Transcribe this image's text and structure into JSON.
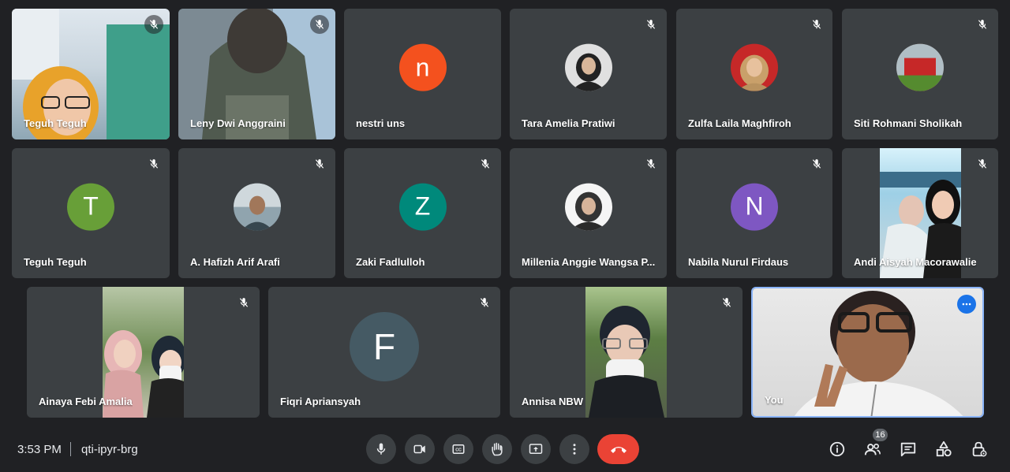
{
  "participants": [
    {
      "name": "Teguh Teguh",
      "tile": "video",
      "muted": true
    },
    {
      "name": "Leny Dwi Anggraini",
      "tile": "video",
      "muted": true
    },
    {
      "name": "nestri uns",
      "tile": "letter-avatar",
      "letter": "n",
      "avatar_color": "#f4511e",
      "muted": false
    },
    {
      "name": "Tara Amelia Pratiwi",
      "tile": "photo-avatar",
      "muted": true
    },
    {
      "name": "Zulfa Laila Maghfiroh",
      "tile": "photo-avatar",
      "muted": true
    },
    {
      "name": "Siti Rohmani Sholikah",
      "tile": "photo-avatar",
      "muted": true
    },
    {
      "name": "Teguh Teguh",
      "tile": "letter-avatar",
      "letter": "T",
      "avatar_color": "#689f38",
      "muted": true
    },
    {
      "name": "A. Hafizh Arif Arafi",
      "tile": "photo-avatar",
      "muted": true
    },
    {
      "name": "Zaki Fadlulloh",
      "tile": "letter-avatar",
      "letter": "Z",
      "avatar_color": "#00897b",
      "muted": true
    },
    {
      "name": "Millenia Anggie Wangsa P...",
      "tile": "photo-avatar",
      "muted": true
    },
    {
      "name": "Nabila Nurul Firdaus",
      "tile": "letter-avatar",
      "letter": "N",
      "avatar_color": "#7e57c2",
      "muted": true
    },
    {
      "name": "Andi Aisyah Macorawalie",
      "tile": "video",
      "muted": true
    },
    {
      "name": "Ainaya Febi Amalia",
      "tile": "video",
      "muted": true
    },
    {
      "name": "Fiqri Apriansyah",
      "tile": "letter-avatar",
      "letter": "F",
      "avatar_color": "#455a64",
      "muted": true
    },
    {
      "name": "Annisa NBW",
      "tile": "video",
      "muted": true
    },
    {
      "name": "You",
      "tile": "video",
      "muted": false,
      "self": true
    }
  ],
  "footer": {
    "time": "3:53 PM",
    "meeting_code": "qti-ipyr-brg",
    "participant_count": "16"
  },
  "controls": [
    "microphone-icon",
    "camera-icon",
    "captions-icon",
    "raise-hand-icon",
    "present-icon",
    "more-options-icon",
    "hang-up-icon"
  ],
  "right_controls": [
    "info-icon",
    "people-icon",
    "chat-icon",
    "activities-icon",
    "host-controls-icon"
  ],
  "colors": {
    "background": "#202124",
    "tile": "#3c4043",
    "hangup": "#ea4335",
    "self_border": "#8ab4f8"
  }
}
